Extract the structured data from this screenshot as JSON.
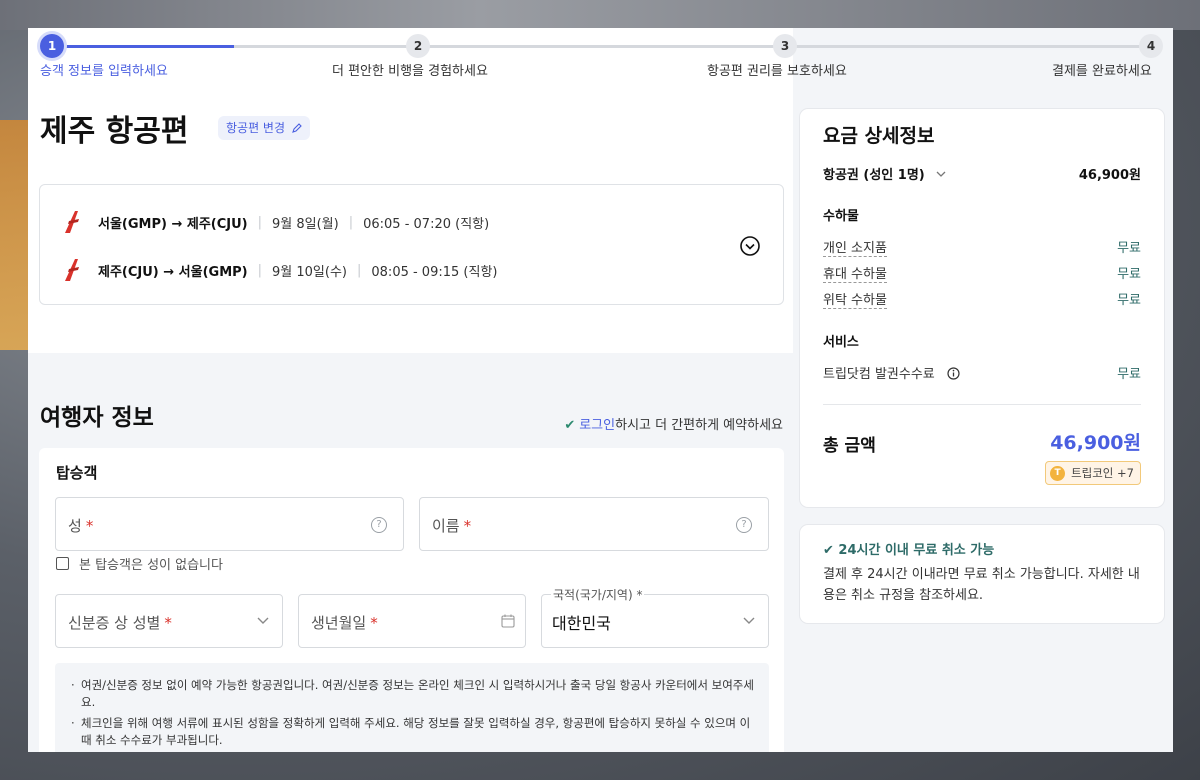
{
  "stepper": {
    "steps": [
      {
        "number": "1",
        "label": "승객 정보를 입력하세요"
      },
      {
        "number": "2",
        "label": "더 편안한 비행을 경험하세요"
      },
      {
        "number": "3",
        "label": "항공편 권리를 보호하세요"
      },
      {
        "number": "4",
        "label": "결제를 완료하세요"
      }
    ],
    "active_step": 1
  },
  "flight": {
    "title": "제주 항공편",
    "change_label": "항공편 변경",
    "legs": [
      {
        "route": "서울(GMP) → 제주(CJU)",
        "date": "9월 8일(월)",
        "time": "06:05 - 07:20 (직항)"
      },
      {
        "route": "제주(CJU) → 서울(GMP)",
        "date": "9월 10일(수)",
        "time": "08:05 - 09:15 (직항)"
      }
    ],
    "airline_color": "#d9322b"
  },
  "traveler": {
    "section_title": "여행자 정보",
    "login_link": "로그인",
    "login_rest": "하시고 더 간편하게 예약하세요",
    "card_title": "탑승객",
    "last_name_label": "성",
    "first_name_label": "이름",
    "required_mark": "*",
    "no_surname_label": "본 탑승객은 성이 없습니다",
    "gender_label": "신분증 상 성별",
    "birth_label": "생년월일",
    "nationality_label": "국적(국가/지역)",
    "nationality_value": "대한민국",
    "notices": [
      "여권/신분증 정보 없이 예약 가능한 항공권입니다. 여권/신분증 정보는 온라인 체크인 시 입력하시거나 출국 당일 항공사 카운터에서 보여주세요.",
      "체크인을 위해 여행 서류에 표시된 성함을 정확하게 입력해 주세요. 해당 정보를 잘못 입력하실 경우, 항공편에 탑승하지 못하실 수 있으며 이때 취소 수수료가 부과됩니다."
    ]
  },
  "fare": {
    "title": "요금 상세정보",
    "ticket_label": "항공권 (성인 1명)",
    "ticket_price": "46,900원",
    "baggage_title": "수하물",
    "baggage_items": [
      {
        "label": "개인 소지품",
        "value": "무료"
      },
      {
        "label": "휴대 수하물",
        "value": "무료"
      },
      {
        "label": "위탁 수하물",
        "value": "무료"
      }
    ],
    "service_title": "서비스",
    "service_label": "트립닷컴 발권수수료",
    "service_value": "무료",
    "total_label": "총 금액",
    "total_value": "46,900원",
    "coin_label": "트립코인 +7",
    "accent_color": "#4a5fe0"
  },
  "cancel": {
    "title": "24시간 이내 무료 취소 가능",
    "desc": "결제 후 24시간 이내라면 무료 취소 가능합니다. 자세한 내용은 취소 규정을 참조하세요."
  }
}
